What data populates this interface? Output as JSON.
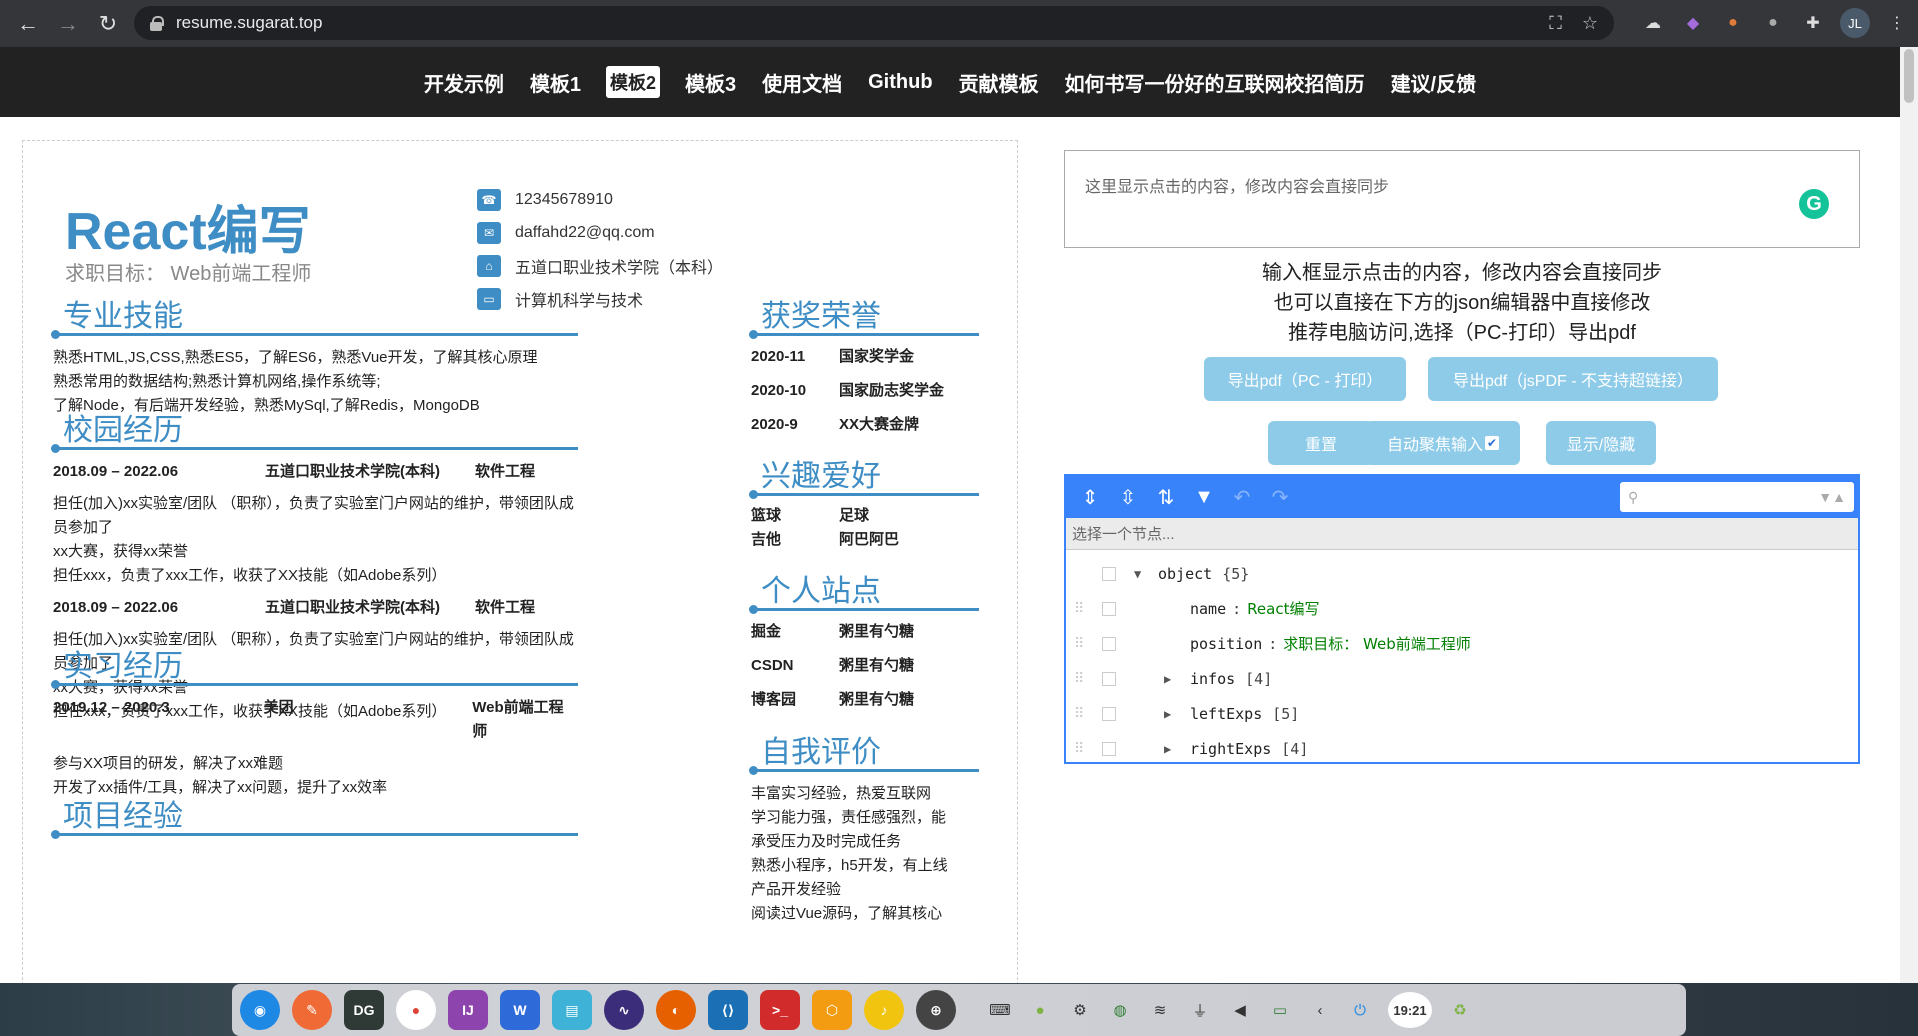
{
  "browser": {
    "url": "resume.sugarat.top",
    "avatar": "JL"
  },
  "site_nav": [
    "开发示例",
    "模板1",
    "模板2",
    "模板3",
    "使用文档",
    "Github",
    "贡献模板",
    "如何书写一份好的互联网校招简历",
    "建议/反馈"
  ],
  "resume": {
    "name": "React编写",
    "objective": "求职目标： Web前端工程师",
    "contacts": [
      {
        "icon": "phone-icon",
        "text": "12345678910"
      },
      {
        "icon": "email-icon",
        "text": "daffahd22@qq.com"
      },
      {
        "icon": "school-icon",
        "text": "五道口职业技术学院（本科）"
      },
      {
        "icon": "computer-icon",
        "text": "计算机科学与技术"
      }
    ],
    "skills": {
      "title": "专业技能",
      "lines": [
        "熟悉HTML,JS,CSS,熟悉ES5，了解ES6，熟悉Vue开发，了解其核心原理",
        "熟悉常用的数据结构;熟悉计算机网络,操作系统等;",
        "了解Node，有后端开发经验，熟悉MySql,了解Redis，MongoDB"
      ]
    },
    "campus": {
      "title": "校园经历",
      "items": [
        {
          "date": "2018.09 – 2022.06",
          "org": "五道口职业技术学院(本科)",
          "role": "软件工程",
          "desc": [
            "担任(加入)xx实验室/团队 （职称），负责了实验室门户网站的维护，带领团队成员参加了",
            "xx大赛，获得xx荣誉",
            "担任xxx，负责了xxx工作，收获了XX技能（如Adobe系列）"
          ]
        },
        {
          "date": "2018.09 – 2022.06",
          "org": "五道口职业技术学院(本科)",
          "role": "软件工程",
          "desc": [
            "担任(加入)xx实验室/团队 （职称），负责了实验室门户网站的维护，带领团队成员参加了",
            "xx大赛，获得xx荣誉",
            "担任xxx，负责了xxx工作，收获了XX技能（如Adobe系列）"
          ]
        }
      ]
    },
    "internship": {
      "title": "实习经历",
      "items": [
        {
          "date": "2019.12 – 2020.3",
          "org": "美团",
          "role": "Web前端工程师",
          "desc": [
            "参与XX项目的研发，解决了xx难题",
            "开发了xx插件/工具，解决了xx问题，提升了xx效率"
          ]
        }
      ]
    },
    "projects": {
      "title": "项目经验"
    },
    "awards": {
      "title": "获奖荣誉",
      "items": [
        {
          "date": "2020-11",
          "name": "国家奖学金"
        },
        {
          "date": "2020-10",
          "name": "国家励志奖学金"
        },
        {
          "date": "2020-9",
          "name": "XX大赛金牌"
        }
      ]
    },
    "hobbies": {
      "title": "兴趣爱好",
      "items": [
        [
          "篮球",
          "足球"
        ],
        [
          "吉他",
          "阿巴阿巴"
        ]
      ]
    },
    "sites": {
      "title": "个人站点",
      "items": [
        {
          "site": "掘金",
          "name": "粥里有勺糖"
        },
        {
          "site": "CSDN",
          "name": "粥里有勺糖"
        },
        {
          "site": "博客园",
          "name": "粥里有勺糖"
        }
      ]
    },
    "self_eval": {
      "title": "自我评价",
      "lines": [
        "丰富实习经验，热爱互联网",
        "学习能力强，责任感强烈，能",
        "承受压力及时完成任务",
        "熟悉小程序，h5开发，有上线",
        "产品开发经验",
        "阅读过Vue源码，了解其核心"
      ]
    }
  },
  "editor": {
    "placeholder": "这里显示点击的内容，修改内容会直接同步",
    "info": [
      "输入框显示点击的内容，修改内容会直接同步",
      "也可以直接在下方的json编辑器中直接修改",
      "推荐电脑访问,选择（PC-打印）导出pdf"
    ],
    "btn_pdf_pc": "导出pdf（PC - 打印）",
    "btn_pdf_js": "导出pdf（jsPDF - 不支持超链接）",
    "btn_reset": "重置",
    "btn_autofocus": "自动聚焦输入",
    "btn_toggle": "显示/隐藏"
  },
  "json_editor": {
    "nav_placeholder": "选择一个节点...",
    "root": {
      "key": "object",
      "meta": "{5}"
    },
    "rows": [
      {
        "key": "name",
        "value": "React编写",
        "expandable": false
      },
      {
        "key": "position",
        "value": "求职目标： Web前端工程师",
        "expandable": false
      },
      {
        "key": "infos",
        "meta": "[4]",
        "expandable": true
      },
      {
        "key": "leftExps",
        "meta": "[5]",
        "expandable": true
      },
      {
        "key": "rightExps",
        "meta": "[4]",
        "expandable": true
      }
    ]
  },
  "taskbar": {
    "clock": "19:21"
  }
}
